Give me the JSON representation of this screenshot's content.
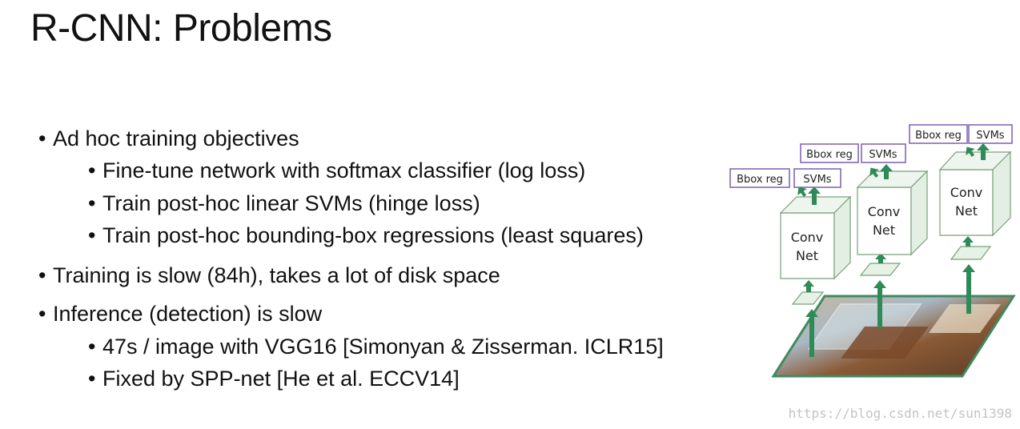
{
  "slide": {
    "title": "R-CNN: Problems",
    "bullets": [
      {
        "text": "Ad hoc training objectives",
        "level": 1
      },
      {
        "text": "Fine-tune network with softmax classifier (log loss)",
        "level": 2
      },
      {
        "text": "Train post-hoc linear SVMs (hinge loss)",
        "level": 2
      },
      {
        "text": "Train post-hoc bounding-box regressions (least squares)",
        "level": 2
      },
      {
        "text": "Training is slow (84h), takes a lot of disk space",
        "level": 1
      },
      {
        "text": "Inference (detection) is slow",
        "level": 1
      },
      {
        "text": "47s / image with VGG16 [Simonyan & Zisserman. ICLR15]",
        "level": 2
      },
      {
        "text": "Fixed by SPP-net [He et al. ECCV14]",
        "level": 2
      }
    ],
    "bullet_glyph": "•"
  },
  "figure": {
    "networks": [
      {
        "bbox_label": "Bbox reg",
        "svm_label": "SVMs",
        "conv_label_1": "Conv",
        "conv_label_2": "Net"
      },
      {
        "bbox_label": "Bbox reg",
        "svm_label": "SVMs",
        "conv_label_1": "Conv",
        "conv_label_2": "Net"
      },
      {
        "bbox_label": "Bbox reg",
        "svm_label": "SVMs",
        "conv_label_1": "Conv",
        "conv_label_2": "Net"
      }
    ],
    "colors": {
      "arrow": "#2e8b57",
      "box_border": "#7b5fb0",
      "cube_stroke": "#7aa07a",
      "image_frame": "#3f8a60"
    }
  },
  "watermark": "https://blog.csdn.net/sun1398"
}
